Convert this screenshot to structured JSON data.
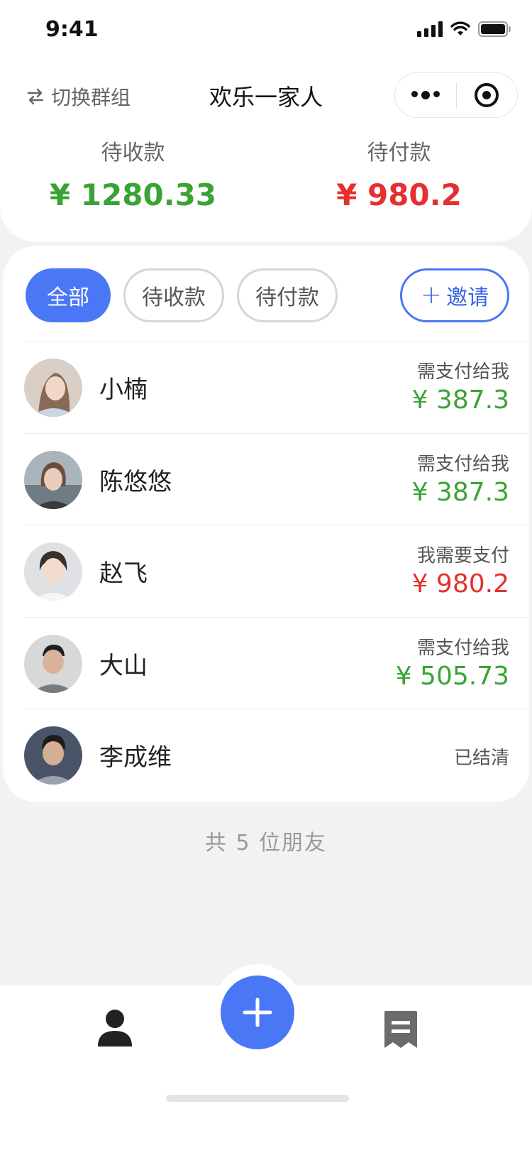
{
  "status_bar": {
    "time": "9:41"
  },
  "header": {
    "switch_label": "切换群组",
    "title": "欢乐一家人"
  },
  "summary": {
    "receivable_label": "待收款",
    "receivable_amount": "¥ 1280.33",
    "payable_label": "待付款",
    "payable_amount": "¥ 980.2"
  },
  "filters": {
    "all": "全部",
    "receivable": "待收款",
    "payable": "待付款",
    "invite": "邀请"
  },
  "friends": [
    {
      "name": "小楠",
      "status": "需支付给我",
      "amount": "¥ 387.3",
      "status_color": "#3aa335"
    },
    {
      "name": "陈悠悠",
      "status": "需支付给我",
      "amount": "¥ 387.3",
      "status_color": "#3aa335"
    },
    {
      "name": "赵飞",
      "status": "我需要支付",
      "amount": "¥ 980.2",
      "status_color": "#e5302e"
    },
    {
      "name": "大山",
      "status": "需支付给我",
      "amount": "¥ 505.73",
      "status_color": "#3aa335"
    },
    {
      "name": "李成维",
      "status": "已结清",
      "amount": ""
    }
  ],
  "footer": {
    "count_text": "共 5 位朋友"
  },
  "colors": {
    "accent": "#4a77f6",
    "positive": "#3aa335",
    "negative": "#e5302e"
  },
  "icons": {
    "switch": "swap-arrows-icon",
    "more": "more-dots-icon",
    "close": "target-circle-icon",
    "add": "plus-icon",
    "tab_profile": "person-icon",
    "tab_bills": "receipt-icon"
  }
}
